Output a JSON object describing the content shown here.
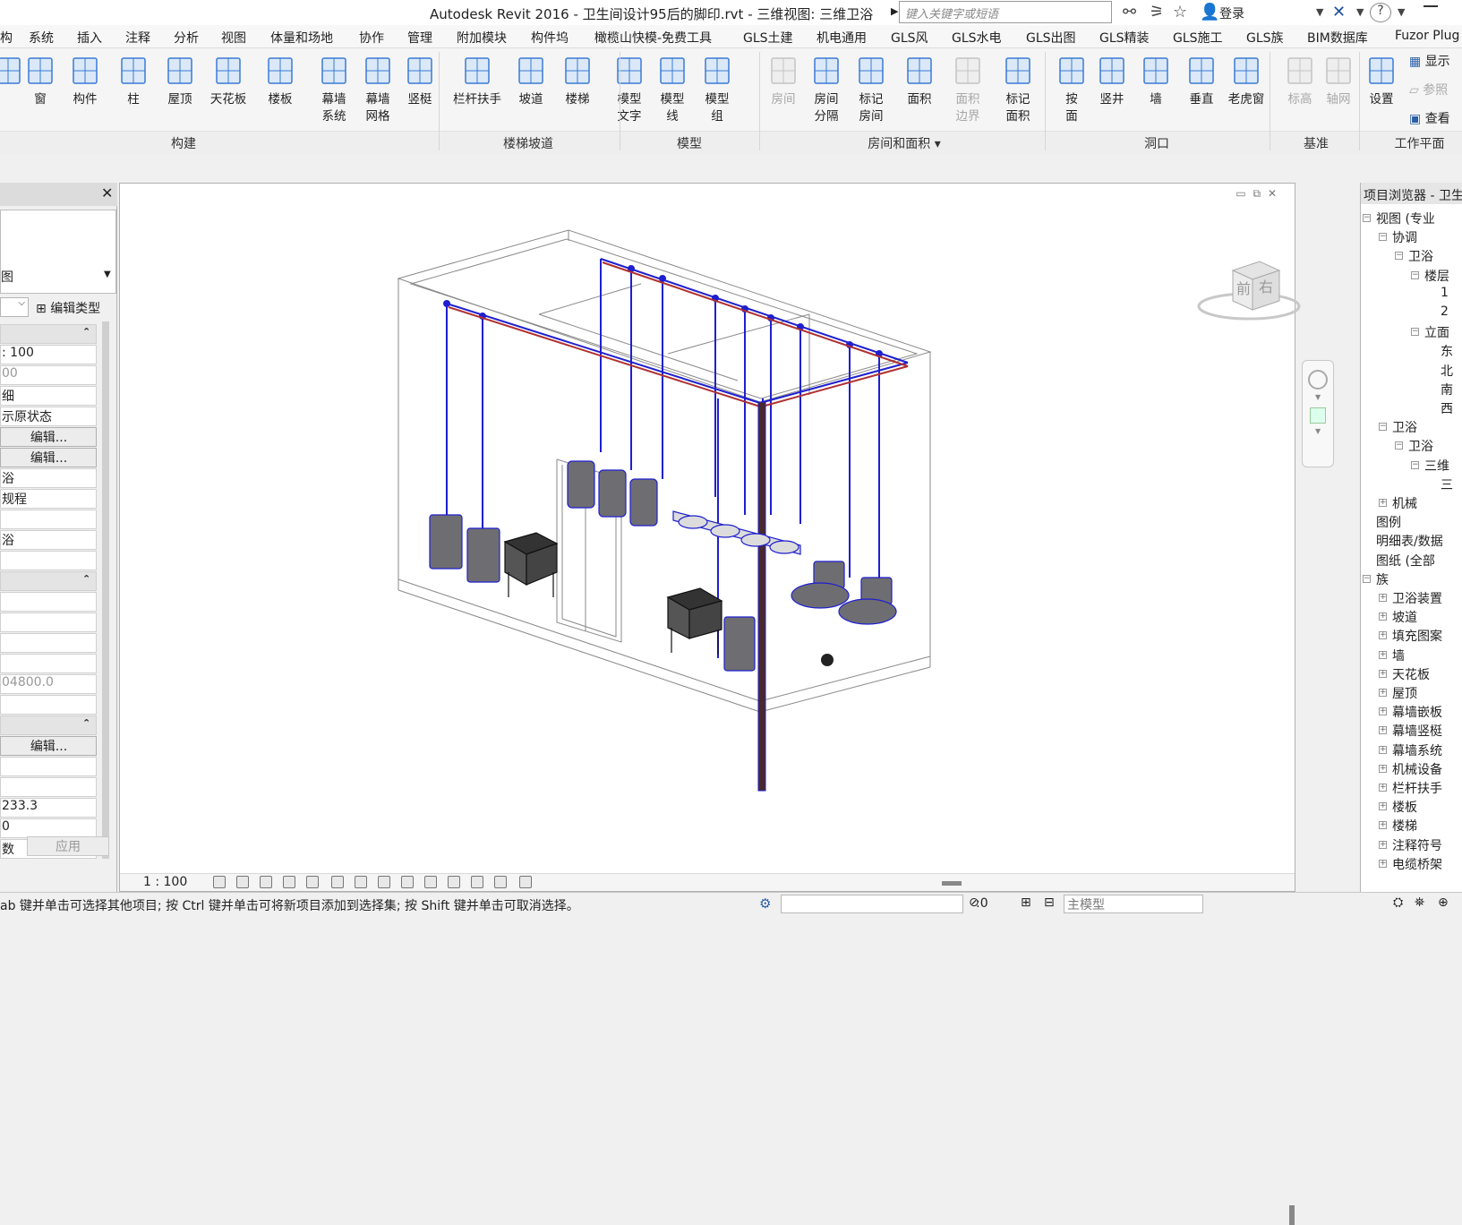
{
  "window": {
    "title": "Autodesk Revit 2016 -    卫生间设计95后的脚印.rvt - 三维视图: 三维卫浴",
    "search_placeholder": "键入关键字或短语",
    "login": "登录"
  },
  "menu": [
    "构",
    "系统",
    "插入",
    "注释",
    "分析",
    "视图",
    "体量和场地",
    "协作",
    "管理",
    "附加模块",
    "构件坞",
    "橄榄山快模-免费工具",
    "GLS土建",
    "机电通用",
    "GLS风",
    "GLS水电",
    "GLS出图",
    "GLS精装",
    "GLS施工",
    "GLS族",
    "BIM数据库",
    "Fuzor Plug"
  ],
  "ribbon": {
    "buttons": [
      {
        "label": "",
        "icon": "door-icon"
      },
      {
        "label": "窗",
        "icon": "window-icon"
      },
      {
        "label": "构件",
        "icon": "component-icon"
      },
      {
        "label": "柱",
        "icon": "column-icon"
      },
      {
        "label": "屋顶",
        "icon": "roof-icon"
      },
      {
        "label": "天花板",
        "icon": "ceiling-icon"
      },
      {
        "label": "楼板",
        "icon": "floor-icon"
      },
      {
        "label": "幕墙\n系统",
        "icon": "curtain-system-icon"
      },
      {
        "label": "幕墙\n网格",
        "icon": "curtain-grid-icon"
      },
      {
        "label": "竖梃",
        "icon": "mullion-icon"
      },
      {
        "label": "栏杆扶手",
        "icon": "railing-icon"
      },
      {
        "label": "坡道",
        "icon": "ramp-icon"
      },
      {
        "label": "楼梯",
        "icon": "stair-icon"
      },
      {
        "label": "模型\n文字",
        "icon": "model-text-icon"
      },
      {
        "label": "模型\n线",
        "icon": "model-line-icon"
      },
      {
        "label": "模型\n组",
        "icon": "model-group-icon"
      },
      {
        "label": "房间",
        "icon": "room-icon",
        "disabled": true
      },
      {
        "label": "房间\n分隔",
        "icon": "room-separator-icon"
      },
      {
        "label": "标记\n房间",
        "icon": "tag-room-icon"
      },
      {
        "label": "面积",
        "icon": "area-icon"
      },
      {
        "label": "面积\n边界",
        "icon": "area-boundary-icon",
        "disabled": true
      },
      {
        "label": "标记\n面积",
        "icon": "tag-area-icon"
      },
      {
        "label": "按\n面",
        "icon": "by-face-icon"
      },
      {
        "label": "竖井",
        "icon": "shaft-icon"
      },
      {
        "label": "墙",
        "icon": "wall-opening-icon"
      },
      {
        "label": "垂直",
        "icon": "vertical-icon"
      },
      {
        "label": "老虎窗",
        "icon": "dormer-icon"
      },
      {
        "label": "标高",
        "icon": "level-icon",
        "disabled": true
      },
      {
        "label": "轴网",
        "icon": "grid-icon",
        "disabled": true
      },
      {
        "label": "设置",
        "icon": "set-icon"
      }
    ],
    "right_items": [
      "显示",
      "参照",
      "查看"
    ],
    "panels": [
      "构建",
      "楼梯坡道",
      "模型",
      "房间和面积 ▾",
      "洞口",
      "基准",
      "工作平面"
    ]
  },
  "properties": {
    "type_label": "图",
    "edit_type": "编辑类型",
    "rows": [
      {
        "t": "",
        "kind": "sect"
      },
      {
        "t": ": 100",
        "kind": ""
      },
      {
        "t": "00",
        "kind": "grey"
      },
      {
        "t": "细",
        "kind": ""
      },
      {
        "t": "示原状态",
        "kind": ""
      },
      {
        "t": "编辑...",
        "kind": "btn"
      },
      {
        "t": "编辑...",
        "kind": "btn"
      },
      {
        "t": "浴",
        "kind": ""
      },
      {
        "t": "规程",
        "kind": ""
      },
      {
        "t": "",
        "kind": ""
      },
      {
        "t": "浴",
        "kind": ""
      },
      {
        "t": "",
        "kind": ""
      },
      {
        "t": "",
        "kind": "sect"
      },
      {
        "t": "",
        "kind": ""
      },
      {
        "t": "",
        "kind": ""
      },
      {
        "t": "",
        "kind": ""
      },
      {
        "t": "",
        "kind": ""
      },
      {
        "t": "04800.0",
        "kind": "grey"
      },
      {
        "t": "",
        "kind": ""
      },
      {
        "t": "",
        "kind": "sect"
      },
      {
        "t": "编辑...",
        "kind": "btn"
      },
      {
        "t": "",
        "kind": ""
      },
      {
        "t": "",
        "kind": ""
      },
      {
        "t": "233.3",
        "kind": ""
      },
      {
        "t": "0",
        "kind": ""
      },
      {
        "t": "数",
        "kind": ""
      }
    ],
    "apply": "应用"
  },
  "viewport": {
    "scale": "1 : 100",
    "viewcube_front": "前",
    "viewcube_right": "右"
  },
  "browser": {
    "title": "项目浏览器 - 卫生",
    "nodes": [
      {
        "label": "视图 (专业",
        "level": 0,
        "exp": "−"
      },
      {
        "label": "协调",
        "level": 1,
        "exp": "−"
      },
      {
        "label": "卫浴",
        "level": 2,
        "exp": "−"
      },
      {
        "label": "楼层",
        "level": 3,
        "exp": "−"
      },
      {
        "label": "1",
        "level": 4,
        "exp": ""
      },
      {
        "label": "2",
        "level": 4,
        "exp": ""
      },
      {
        "label": "立面",
        "level": 3,
        "exp": "−"
      },
      {
        "label": "东",
        "level": 4,
        "exp": ""
      },
      {
        "label": "北",
        "level": 4,
        "exp": ""
      },
      {
        "label": "南",
        "level": 4,
        "exp": ""
      },
      {
        "label": "西",
        "level": 4,
        "exp": ""
      },
      {
        "label": "卫浴",
        "level": 1,
        "exp": "−"
      },
      {
        "label": "卫浴",
        "level": 2,
        "exp": "−"
      },
      {
        "label": "三维",
        "level": 3,
        "exp": "−"
      },
      {
        "label": "三",
        "level": 4,
        "exp": ""
      },
      {
        "label": "机械",
        "level": 1,
        "exp": "+"
      },
      {
        "label": "图例",
        "level": 0,
        "exp": ""
      },
      {
        "label": "明细表/数据",
        "level": 0,
        "exp": ""
      },
      {
        "label": "图纸 (全部",
        "level": 0,
        "exp": ""
      },
      {
        "label": "族",
        "level": 0,
        "exp": "−"
      },
      {
        "label": "卫浴装置",
        "level": 1,
        "exp": "+"
      },
      {
        "label": "坡道",
        "level": 1,
        "exp": "+"
      },
      {
        "label": "填充图案",
        "level": 1,
        "exp": "+"
      },
      {
        "label": "墙",
        "level": 1,
        "exp": "+"
      },
      {
        "label": "天花板",
        "level": 1,
        "exp": "+"
      },
      {
        "label": "屋顶",
        "level": 1,
        "exp": "+"
      },
      {
        "label": "幕墙嵌板",
        "level": 1,
        "exp": "+"
      },
      {
        "label": "幕墙竖梃",
        "level": 1,
        "exp": "+"
      },
      {
        "label": "幕墙系统",
        "level": 1,
        "exp": "+"
      },
      {
        "label": "机械设备",
        "level": 1,
        "exp": "+"
      },
      {
        "label": "栏杆扶手",
        "level": 1,
        "exp": "+"
      },
      {
        "label": "楼板",
        "level": 1,
        "exp": "+"
      },
      {
        "label": "楼梯",
        "level": 1,
        "exp": "+"
      },
      {
        "label": "注释符号",
        "level": 1,
        "exp": "+"
      },
      {
        "label": "电缆桥架",
        "level": 1,
        "exp": "+"
      }
    ]
  },
  "status": {
    "text": "ab 键并单击可选择其他项目; 按 Ctrl 键并单击可将新项目添加到选择集; 按 Shift 键并单击可取消选择。",
    "select_count": ":0",
    "model": "主模型"
  },
  "colors": {
    "pipe_blue": "#1f1fd0",
    "pipe_red": "#b03030",
    "fixture_gray": "#6e6e72"
  }
}
